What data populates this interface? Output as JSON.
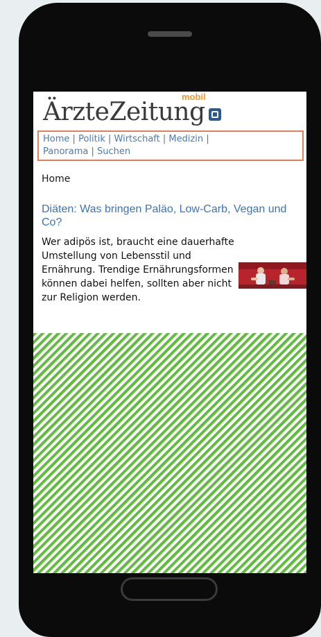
{
  "site": {
    "logo_text": "ÄrzteZeitung",
    "logo_tag": "mobil",
    "logo_icon": "book-icon"
  },
  "nav": {
    "items": [
      "Home",
      "Politik",
      "Wirtschaft",
      "Medizin",
      "Panorama",
      "Suchen"
    ],
    "separator": "|"
  },
  "breadcrumb": "Home",
  "article": {
    "headline": "Diäten: Was bringen Paläo, Low-Carb, Vegan und Co?",
    "teaser": "Wer adipös ist, braucht eine dauerhafte Umstellung von Lebensstil und Ernährung. Trendige Ernährungsformen können dabei helfen, sollten aber nicht zur Religion werden."
  },
  "colors": {
    "accent_link": "#4a7cb4",
    "nav_border": "#e57f5b",
    "logo_tag": "#f39a2b",
    "ad_stripe": "#5fbf3c",
    "phone_body": "#0b0b0b"
  }
}
